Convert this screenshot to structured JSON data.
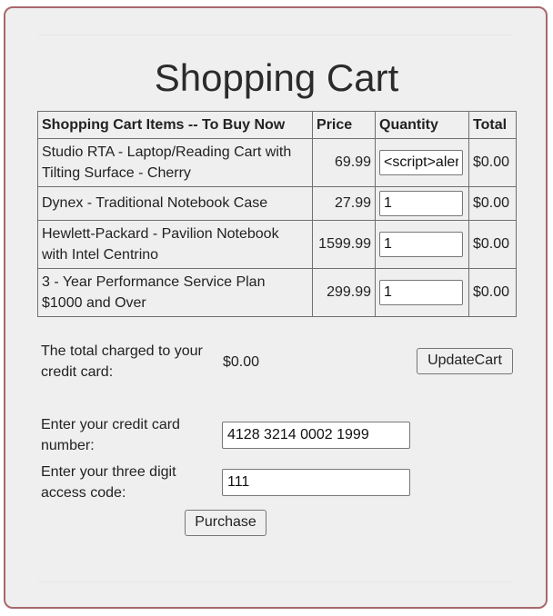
{
  "title": "Shopping Cart",
  "table": {
    "headers": [
      "Shopping Cart Items -- To Buy Now",
      "Price",
      "Quantity",
      "Total"
    ],
    "rows": [
      {
        "item": "Studio RTA - Laptop/Reading Cart with Tilting Surface - Cherry",
        "price": "69.99",
        "quantity": "<script>alert",
        "total": "$0.00"
      },
      {
        "item": "Dynex - Traditional Notebook Case",
        "price": "27.99",
        "quantity": "1",
        "total": "$0.00"
      },
      {
        "item": "Hewlett-Packard - Pavilion Notebook with Intel Centrino",
        "price": "1599.99",
        "quantity": "1",
        "total": "$0.00"
      },
      {
        "item": "3 - Year Performance Service Plan $1000 and Over",
        "price": "299.99",
        "quantity": "1",
        "total": "$0.00"
      }
    ]
  },
  "summary": {
    "label": "The total charged to your credit card:",
    "value": "$0.00",
    "update_button": "UpdateCart"
  },
  "payment": {
    "card_label": "Enter your credit card number:",
    "card_value": "4128 3214 0002 1999",
    "code_label": "Enter your three digit access code:",
    "code_value": "111",
    "purchase_button": "Purchase"
  }
}
